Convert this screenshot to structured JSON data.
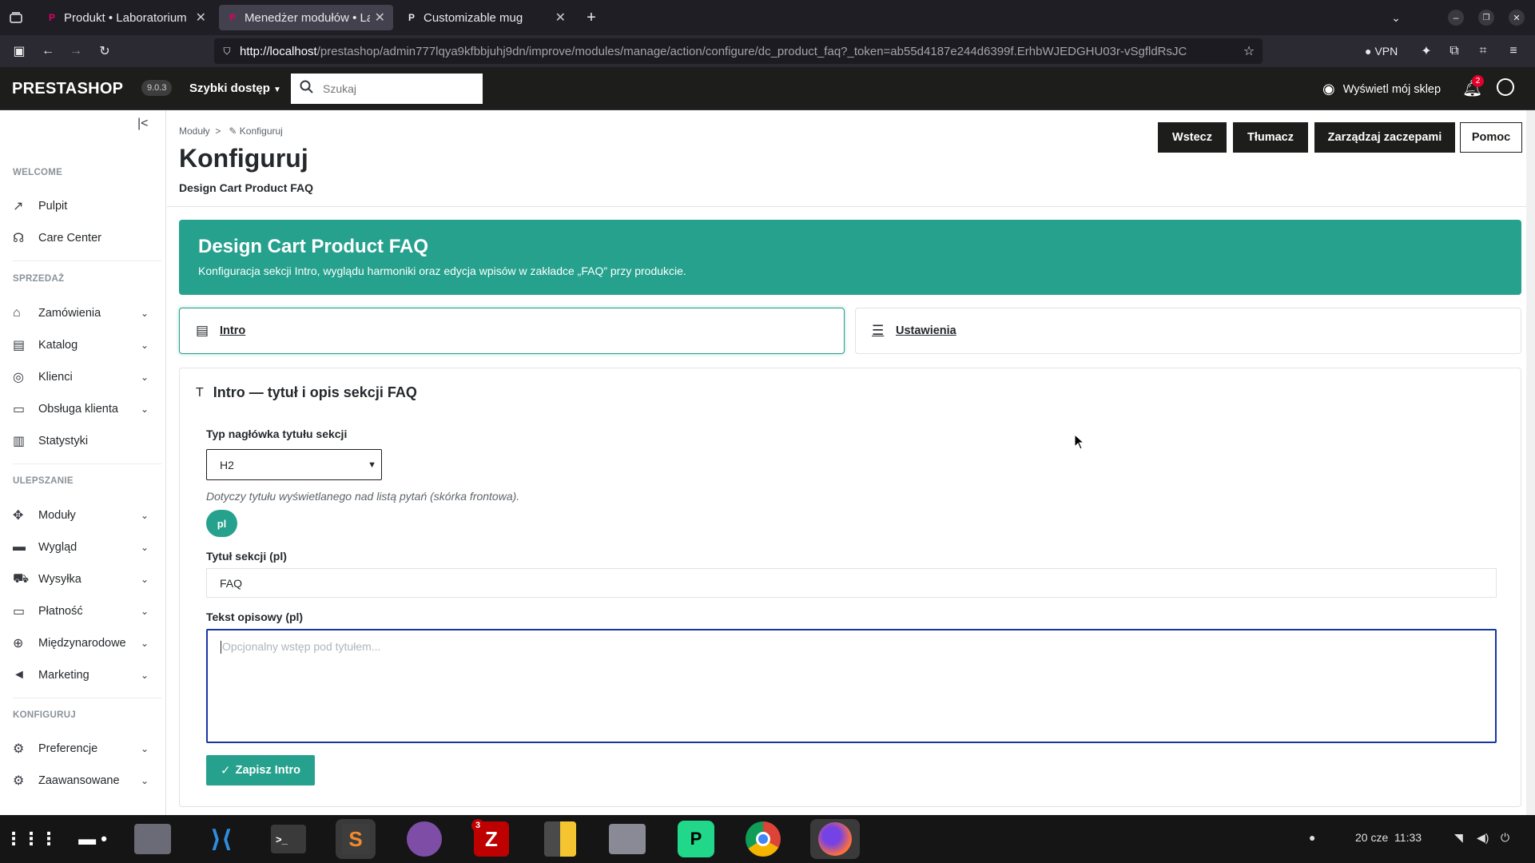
{
  "browser": {
    "tabs": [
      {
        "title": "Produkt • Laboratorium",
        "favicon": "P"
      },
      {
        "title": "Menedżer modułów • Lab",
        "favicon": "P"
      },
      {
        "title": "Customizable mug",
        "favicon": "P"
      }
    ],
    "url_host": "http://localhost",
    "url_path": "/prestashop/admin777lqya9kfbbjuhj9dn/improve/modules/manage/action/configure/dc_product_faq?_token=ab55d4187e244d6399f.ErhbWJEDGHU03r-vSgfldRsJC",
    "vpn_label": "VPN"
  },
  "header": {
    "logo": "PRESTASHOP",
    "version": "9.0.3",
    "quick_access": "Szybki dostęp",
    "search_placeholder": "Szukaj",
    "view_shop": "Wyświetl mój sklep",
    "notifications_count": "2"
  },
  "sidebar": {
    "sections": [
      {
        "title": "WELCOME"
      },
      {
        "title": "SPRZEDAŻ"
      },
      {
        "title": "ULEPSZANIE"
      },
      {
        "title": "KONFIGURUJ"
      }
    ],
    "items": [
      {
        "label": "Pulpit",
        "icon": "trending-up-icon"
      },
      {
        "label": "Care Center",
        "icon": "headset-icon"
      },
      {
        "label": "Zamówienia",
        "icon": "basket-icon"
      },
      {
        "label": "Katalog",
        "icon": "store-icon"
      },
      {
        "label": "Klienci",
        "icon": "account-icon"
      },
      {
        "label": "Obsługa klienta",
        "icon": "chat-icon"
      },
      {
        "label": "Statystyki",
        "icon": "bar-chart-icon"
      },
      {
        "label": "Moduły",
        "icon": "puzzle-icon"
      },
      {
        "label": "Wygląd",
        "icon": "desktop-icon"
      },
      {
        "label": "Wysyłka",
        "icon": "truck-icon"
      },
      {
        "label": "Płatność",
        "icon": "credit-card-icon"
      },
      {
        "label": "Międzynarodowe",
        "icon": "globe-icon"
      },
      {
        "label": "Marketing",
        "icon": "campaign-icon"
      },
      {
        "label": "Preferencje",
        "icon": "settings-icon"
      },
      {
        "label": "Zaawansowane",
        "icon": "settings-app-icon"
      }
    ]
  },
  "toolbar": {
    "breadcrumb_parent": "Moduły",
    "breadcrumb_current": "Konfiguruj",
    "title": "Konfiguruj",
    "subtitle": "Design Cart Product FAQ",
    "buttons": {
      "back": "Wstecz",
      "translate": "Tłumacz",
      "hooks": "Zarządzaj zaczepami",
      "help": "Pomoc"
    }
  },
  "hero": {
    "title": "Design Cart Product FAQ",
    "description": "Konfiguracja sekcji Intro, wyglądu harmoniki oraz edycja wpisów w zakładce „FAQ” przy produkcie."
  },
  "tabs": {
    "intro": "Intro",
    "settings": "Ustawienia"
  },
  "panel": {
    "heading": "Intro — tytuł i opis sekcji FAQ",
    "heading_type_label": "Typ nagłówka tytułu sekcji",
    "heading_type_value": "H2",
    "heading_type_help": "Dotyczy tytułu wyświetlanego nad listą pytań (skórka frontowa).",
    "language": "pl",
    "section_title_label": "Tytuł sekcji (pl)",
    "section_title_value": "FAQ",
    "description_label": "Tekst opisowy (pl)",
    "description_placeholder": "Opcjonalny wstęp pod tytułem...",
    "save_button": "Zapisz Intro"
  },
  "taskbar": {
    "filezilla_badge": "3",
    "date": "20 cze",
    "time": "11:33"
  },
  "colors": {
    "accent": "#25a18d",
    "header_bg": "#1d1d1b",
    "focus_border": "#1537a1"
  }
}
